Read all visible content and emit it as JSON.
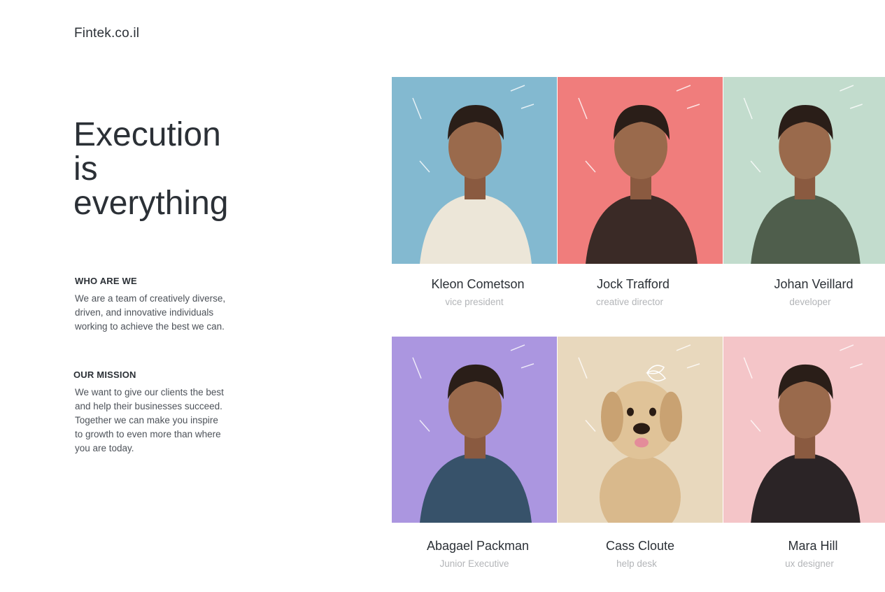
{
  "site": {
    "logo": "Fintek.co.il"
  },
  "hero": {
    "headline_lines": [
      "Execution",
      "is",
      "everything"
    ]
  },
  "sections": {
    "who": {
      "title": "WHO ARE WE",
      "lines": [
        "We are a team of creatively diverse,",
        "driven, and innovative individuals",
        "working to achieve the best we can."
      ]
    },
    "mission": {
      "title": "OUR MISSION",
      "lines": [
        "We want to give our clients the best",
        "and help their businesses succeed.",
        "Together we can make you inspire",
        "to growth to even more than where",
        "you are today."
      ]
    }
  },
  "team": [
    {
      "name": "Kleon Cometson",
      "role": "vice president",
      "bg": "#83b9d0",
      "subject": "person-woman-icon"
    },
    {
      "name": "Jock Trafford",
      "role": "creative director",
      "bg": "#f07d7c",
      "subject": "person-man-icon"
    },
    {
      "name": "Johan Veillard",
      "role": "developer",
      "bg": "#c2dccd",
      "subject": "person-man-icon"
    },
    {
      "name": "Abagael Packman",
      "role": "Junior Executive",
      "bg": "#ab96e0",
      "subject": "person-woman-icon"
    },
    {
      "name": "Cass Cloute",
      "role": "help desk",
      "bg": "#e8d8bd",
      "subject": "puppy-icon"
    },
    {
      "name": "Mara Hill",
      "role": "ux designer",
      "bg": "#f4c5c8",
      "subject": "person-woman-icon"
    }
  ]
}
